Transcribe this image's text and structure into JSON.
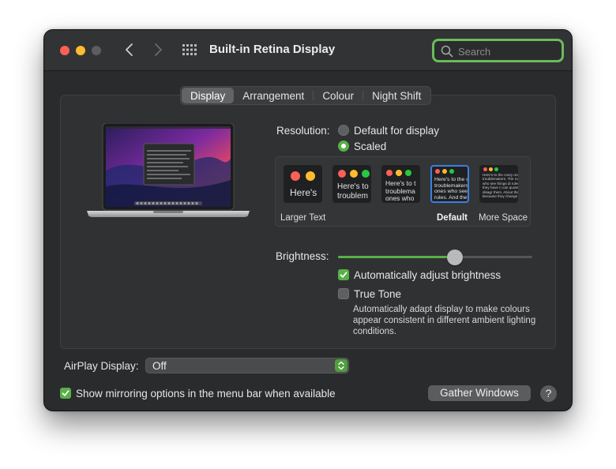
{
  "window": {
    "title": "Built-in Retina Display",
    "search_placeholder": "Search"
  },
  "tabs": [
    {
      "label": "Display",
      "selected": true
    },
    {
      "label": "Arrangement",
      "selected": false
    },
    {
      "label": "Colour",
      "selected": false
    },
    {
      "label": "Night Shift",
      "selected": false
    }
  ],
  "resolution": {
    "label": "Resolution:",
    "options": [
      {
        "label": "Default for display",
        "selected": false
      },
      {
        "label": "Scaled",
        "selected": true
      }
    ],
    "thumbnails": [
      {
        "text": "Here's",
        "selected": false
      },
      {
        "text": "Here's to troublem",
        "selected": false
      },
      {
        "text": "Here's to t troublema ones who",
        "selected": false
      },
      {
        "text": "Here's to the cr troublemakers. ones who see t rules. And they",
        "selected": true
      },
      {
        "text": "Here's to the crazy one troublemakers. The ro ones who see things di rules. And they have n can quote them, disagr them. About the only th Because they change th",
        "selected": false
      }
    ],
    "scale_labels": {
      "left": "Larger Text",
      "default": "Default",
      "right": "More Space"
    }
  },
  "brightness": {
    "label": "Brightness:",
    "level": 0.6,
    "auto_adjust": {
      "label": "Automatically adjust brightness",
      "checked": true
    },
    "true_tone": {
      "label": "True Tone",
      "checked": false
    },
    "true_tone_description": "Automatically adapt display to make colours appear consistent in different ambient lighting conditions."
  },
  "airplay": {
    "label": "AirPlay Display:",
    "value": "Off"
  },
  "mirroring": {
    "label": "Show mirroring options in the menu bar when available",
    "checked": true
  },
  "buttons": {
    "gather_windows": "Gather Windows",
    "help": "?"
  },
  "colors": {
    "accent": "#58b046",
    "window_bg": "#2a2b2d",
    "selection_blue": "#3b7fe0"
  }
}
